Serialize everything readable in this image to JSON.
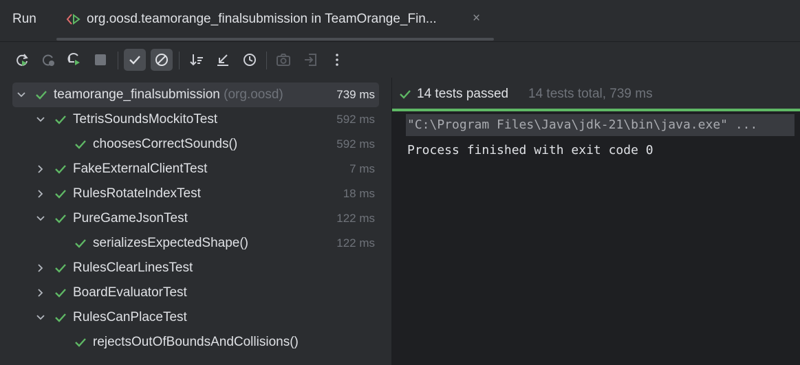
{
  "header": {
    "title": "Run",
    "tab_label": "org.oosd.teamorange_finalsubmission in TeamOrange_Fin...",
    "tab_icon": "run-config-icon",
    "close_glyph": "×"
  },
  "toolbar": {
    "buttons": [
      "rerun-icon",
      "rerun-failed-icon",
      "toggle-auto-test-icon",
      "stop-icon",
      "show-passed-icon",
      "show-ignored-icon",
      "sort-icon",
      "collapse-all-icon",
      "history-icon",
      "screenshot-icon",
      "export-icon",
      "more-icon"
    ]
  },
  "tree": {
    "rows": [
      {
        "name": "teamorange_finalsubmission",
        "pkg": "(org.oosd)",
        "duration": "739 ms",
        "level": 0,
        "expanded": true
      },
      {
        "name": "TetrisSoundsMockitoTest",
        "duration": "592 ms",
        "level": 1,
        "expanded": true
      },
      {
        "name": "choosesCorrectSounds()",
        "duration": "592 ms",
        "level": 2
      },
      {
        "name": "FakeExternalClientTest",
        "duration": "7 ms",
        "level": 1,
        "expanded": false
      },
      {
        "name": "RulesRotateIndexTest",
        "duration": "18 ms",
        "level": 1,
        "expanded": false
      },
      {
        "name": "PureGameJsonTest",
        "duration": "122 ms",
        "level": 1,
        "expanded": true
      },
      {
        "name": "serializesExpectedShape()",
        "duration": "122 ms",
        "level": 2
      },
      {
        "name": "RulesClearLinesTest",
        "duration": "",
        "level": 1,
        "expanded": false
      },
      {
        "name": "BoardEvaluatorTest",
        "duration": "",
        "level": 1,
        "expanded": false
      },
      {
        "name": "RulesCanPlaceTest",
        "duration": "",
        "level": 1,
        "expanded": true
      },
      {
        "name": "rejectsOutOfBoundsAndCollisions()",
        "duration": "",
        "level": 2
      }
    ]
  },
  "status": {
    "passed": "14 tests passed",
    "total": "14 tests total, 739 ms",
    "progress": 1.0
  },
  "console": {
    "line1": "\"C:\\Program Files\\Java\\jdk-21\\bin\\java.exe\" ...",
    "line2": "Process finished with exit code 0"
  },
  "colors": {
    "pass": "#5fb865",
    "accent_red": "#e06c6c"
  }
}
